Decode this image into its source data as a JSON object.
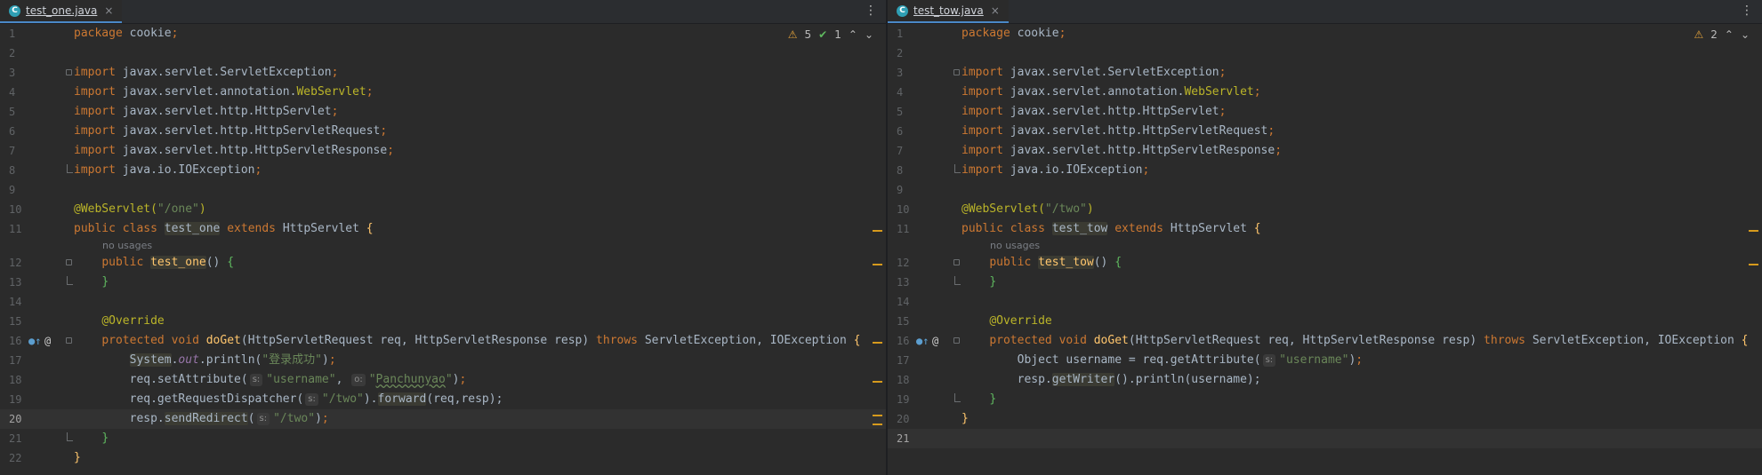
{
  "left": {
    "tab": {
      "icon": "C",
      "label": "test_one.java",
      "close": "×"
    },
    "inspections": {
      "warnings": "5",
      "ok": "1"
    },
    "hint": "no usages",
    "code": {
      "l1_pkg": "cookie",
      "l3": "javax.servlet.ServletException",
      "l4a": "javax.servlet.annotation.",
      "l4b": "WebServlet",
      "l5": "javax.servlet.http.HttpServlet",
      "l6": "javax.servlet.http.HttpServletRequest",
      "l7": "javax.servlet.http.HttpServletResponse",
      "l8": "java.io.IOException",
      "l10_path": "\"/one\"",
      "class_name": "test_one",
      "super": "HttpServlet",
      "ctor": "test_one",
      "override": "@Override",
      "method": "doGet",
      "params": "(HttpServletRequest req, HttpServletResponse resp)",
      "exc": "ServletException, IOException",
      "l17_sys": "System",
      "l17_out": "out",
      "l17_call": ".println(",
      "l17_str": "\"登录成功\"",
      "l18_call": "req.setAttribute(",
      "l18_s": "s:",
      "l18_str1": "\"username\"",
      "l18_o": "o:",
      "l18_str2": "Panchunyao",
      "l19_call": "req.getRequestDispatcher(",
      "l19_s": "s:",
      "l19_str": "\"/two\"",
      "l19_fwd": "forward",
      "l19_args": "(req,resp);",
      "l20_obj": "resp.",
      "l20_m": "sendRedirect",
      "l20_s": "s:",
      "l20_str": "\"/two\""
    }
  },
  "right": {
    "tab": {
      "icon": "C",
      "label": "test_tow.java",
      "close": "×"
    },
    "inspections": {
      "warnings": "2"
    },
    "hint": "no usages",
    "code": {
      "l1_pkg": "cookie",
      "l3": "javax.servlet.ServletException",
      "l4a": "javax.servlet.annotation.",
      "l4b": "WebServlet",
      "l5": "javax.servlet.http.HttpServlet",
      "l6": "javax.servlet.http.HttpServletRequest",
      "l7": "javax.servlet.http.HttpServletResponse",
      "l8": "java.io.IOException",
      "l10_path": "\"/two\"",
      "class_name": "test_tow",
      "super": "HttpServlet",
      "ctor": "test_tow",
      "override": "@Override",
      "method": "doGet",
      "params": "(HttpServletRequest req, HttpServletResponse resp)",
      "exc": "ServletException, IOException",
      "l17_a": "Object username = req.getAttribute(",
      "l17_s": "s:",
      "l17_str": "\"username\"",
      "l18_a": "resp.",
      "l18_m": "getWriter",
      "l18_b": "().println(username);"
    }
  },
  "line_numbers": [
    "1",
    "2",
    "3",
    "4",
    "5",
    "6",
    "7",
    "8",
    "9",
    "10",
    "11",
    "12",
    "13",
    "14",
    "15",
    "16",
    "17",
    "18",
    "19",
    "20",
    "21",
    "22"
  ],
  "keywords": {
    "package": "package",
    "import": "import",
    "public": "public",
    "class": "class",
    "extends": "extends",
    "protected": "protected",
    "void": "void",
    "throws": "throws"
  },
  "colors": {
    "keyword": "#cc7832",
    "annotation": "#bbb529",
    "string": "#6a8759",
    "method": "#ffc66d",
    "warning": "#e0a03a"
  }
}
